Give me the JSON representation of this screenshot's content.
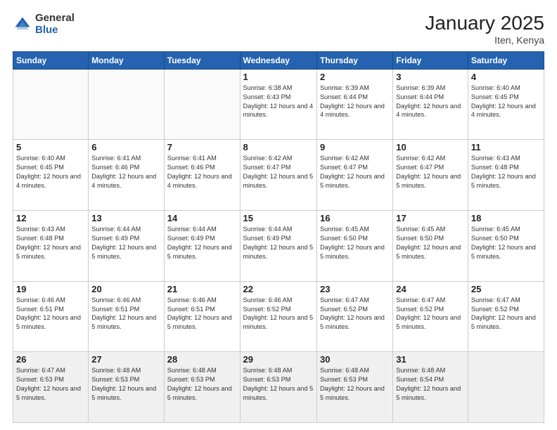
{
  "header": {
    "logo_general": "General",
    "logo_blue": "Blue",
    "month_title": "January 2025",
    "location": "Iten, Kenya"
  },
  "days_of_week": [
    "Sunday",
    "Monday",
    "Tuesday",
    "Wednesday",
    "Thursday",
    "Friday",
    "Saturday"
  ],
  "weeks": [
    [
      {
        "day": "",
        "content": ""
      },
      {
        "day": "",
        "content": ""
      },
      {
        "day": "",
        "content": ""
      },
      {
        "day": "1",
        "content": "Sunrise: 6:38 AM\nSunset: 6:43 PM\nDaylight: 12 hours\nand 4 minutes."
      },
      {
        "day": "2",
        "content": "Sunrise: 6:39 AM\nSunset: 6:44 PM\nDaylight: 12 hours\nand 4 minutes."
      },
      {
        "day": "3",
        "content": "Sunrise: 6:39 AM\nSunset: 6:44 PM\nDaylight: 12 hours\nand 4 minutes."
      },
      {
        "day": "4",
        "content": "Sunrise: 6:40 AM\nSunset: 6:45 PM\nDaylight: 12 hours\nand 4 minutes."
      }
    ],
    [
      {
        "day": "5",
        "content": "Sunrise: 6:40 AM\nSunset: 6:45 PM\nDaylight: 12 hours\nand 4 minutes."
      },
      {
        "day": "6",
        "content": "Sunrise: 6:41 AM\nSunset: 6:46 PM\nDaylight: 12 hours\nand 4 minutes."
      },
      {
        "day": "7",
        "content": "Sunrise: 6:41 AM\nSunset: 6:46 PM\nDaylight: 12 hours\nand 4 minutes."
      },
      {
        "day": "8",
        "content": "Sunrise: 6:42 AM\nSunset: 6:47 PM\nDaylight: 12 hours\nand 5 minutes."
      },
      {
        "day": "9",
        "content": "Sunrise: 6:42 AM\nSunset: 6:47 PM\nDaylight: 12 hours\nand 5 minutes."
      },
      {
        "day": "10",
        "content": "Sunrise: 6:42 AM\nSunset: 6:47 PM\nDaylight: 12 hours\nand 5 minutes."
      },
      {
        "day": "11",
        "content": "Sunrise: 6:43 AM\nSunset: 6:48 PM\nDaylight: 12 hours\nand 5 minutes."
      }
    ],
    [
      {
        "day": "12",
        "content": "Sunrise: 6:43 AM\nSunset: 6:48 PM\nDaylight: 12 hours\nand 5 minutes."
      },
      {
        "day": "13",
        "content": "Sunrise: 6:44 AM\nSunset: 6:49 PM\nDaylight: 12 hours\nand 5 minutes."
      },
      {
        "day": "14",
        "content": "Sunrise: 6:44 AM\nSunset: 6:49 PM\nDaylight: 12 hours\nand 5 minutes."
      },
      {
        "day": "15",
        "content": "Sunrise: 6:44 AM\nSunset: 6:49 PM\nDaylight: 12 hours\nand 5 minutes."
      },
      {
        "day": "16",
        "content": "Sunrise: 6:45 AM\nSunset: 6:50 PM\nDaylight: 12 hours\nand 5 minutes."
      },
      {
        "day": "17",
        "content": "Sunrise: 6:45 AM\nSunset: 6:50 PM\nDaylight: 12 hours\nand 5 minutes."
      },
      {
        "day": "18",
        "content": "Sunrise: 6:45 AM\nSunset: 6:50 PM\nDaylight: 12 hours\nand 5 minutes."
      }
    ],
    [
      {
        "day": "19",
        "content": "Sunrise: 6:46 AM\nSunset: 6:51 PM\nDaylight: 12 hours\nand 5 minutes."
      },
      {
        "day": "20",
        "content": "Sunrise: 6:46 AM\nSunset: 6:51 PM\nDaylight: 12 hours\nand 5 minutes."
      },
      {
        "day": "21",
        "content": "Sunrise: 6:46 AM\nSunset: 6:51 PM\nDaylight: 12 hours\nand 5 minutes."
      },
      {
        "day": "22",
        "content": "Sunrise: 6:46 AM\nSunset: 6:52 PM\nDaylight: 12 hours\nand 5 minutes."
      },
      {
        "day": "23",
        "content": "Sunrise: 6:47 AM\nSunset: 6:52 PM\nDaylight: 12 hours\nand 5 minutes."
      },
      {
        "day": "24",
        "content": "Sunrise: 6:47 AM\nSunset: 6:52 PM\nDaylight: 12 hours\nand 5 minutes."
      },
      {
        "day": "25",
        "content": "Sunrise: 6:47 AM\nSunset: 6:52 PM\nDaylight: 12 hours\nand 5 minutes."
      }
    ],
    [
      {
        "day": "26",
        "content": "Sunrise: 6:47 AM\nSunset: 6:53 PM\nDaylight: 12 hours\nand 5 minutes."
      },
      {
        "day": "27",
        "content": "Sunrise: 6:48 AM\nSunset: 6:53 PM\nDaylight: 12 hours\nand 5 minutes."
      },
      {
        "day": "28",
        "content": "Sunrise: 6:48 AM\nSunset: 6:53 PM\nDaylight: 12 hours\nand 5 minutes."
      },
      {
        "day": "29",
        "content": "Sunrise: 6:48 AM\nSunset: 6:53 PM\nDaylight: 12 hours\nand 5 minutes."
      },
      {
        "day": "30",
        "content": "Sunrise: 6:48 AM\nSunset: 6:53 PM\nDaylight: 12 hours\nand 5 minutes."
      },
      {
        "day": "31",
        "content": "Sunrise: 6:48 AM\nSunset: 6:54 PM\nDaylight: 12 hours\nand 5 minutes."
      },
      {
        "day": "",
        "content": ""
      }
    ]
  ]
}
